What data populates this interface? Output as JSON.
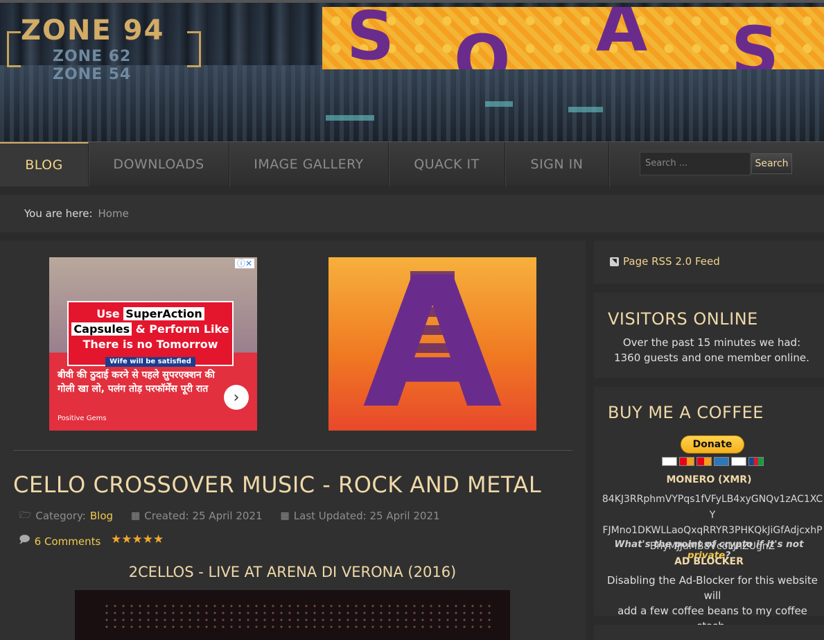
{
  "header": {
    "logo": {
      "line1": "ZONE 94",
      "line2": "ZONE 62",
      "line3": "ZONE 54"
    },
    "banner_letters": [
      "S",
      "O",
      "A",
      "S"
    ]
  },
  "nav": {
    "items": [
      {
        "label": "BLOG",
        "active": true
      },
      {
        "label": "DOWNLOADS",
        "active": false
      },
      {
        "label": "IMAGE GALLERY",
        "active": false
      },
      {
        "label": "QUACK IT",
        "active": false
      },
      {
        "label": "SIGN IN",
        "active": false
      }
    ],
    "search": {
      "placeholder": "Search ...",
      "button_label": "Search"
    }
  },
  "breadcrumb": {
    "label": "You are here:",
    "home": "Home"
  },
  "ads": {
    "ad1": {
      "adchoices": "ⓘ✕",
      "headline_pre": "Use",
      "headline_highlight1": "SuperAction",
      "headline_highlight2": "Capsules",
      "headline_mid": "& Perform Like",
      "headline_end": "There is no Tomorrow",
      "tagline": "Wife will be satisfied",
      "hindi_text": "बीवी की ठुदाई करने से पहले सुपरएक्शन की गोली खा लो, पलंग तोड़ परफॉर्मेंस पूरी रात",
      "brand": "Positive Gems"
    },
    "ad2": {
      "letter": "A"
    }
  },
  "article": {
    "title": "CELLO CROSSOVER MUSIC - ROCK AND METAL",
    "category_label": "Category:",
    "category": "Blog",
    "created": "Created: 25 April 2021",
    "updated": "Last Updated: 25 April 2021",
    "comments": "6 Comments",
    "rating": 5,
    "rating_stars": "★★★★★",
    "video_title": "2CELLOS - LIVE AT ARENA DI VERONA (2016)"
  },
  "sidebar": {
    "rss": "Page RSS 2.0 Feed",
    "visitors": {
      "title": "VISITORS ONLINE",
      "line1": "Over the past 15 minutes we had:",
      "line2": "1360 guests and one member online."
    },
    "coffee": {
      "title": "BUY ME A COFFEE",
      "donate": "Donate",
      "monero_heading": "MONERO (XMR)",
      "xmr_line1": "84KJ3RRphmVYPqs1fVFyLB4xyGNQv1zAC1XCY",
      "xmr_line2": "FJMno1DKWLLaoQxqRRYR3PHKQkJiGfAdjcxhP",
      "xmr_line3": "BhyMJJuMB8VcoLJnZUgnZ",
      "crypto_note_pre": "What's the point of crypto if it's not",
      "crypto_note_em": "private",
      "crypto_note_post": "?",
      "adblock_heading": "AD BLOCKER",
      "adblock_line1": "Disabling the Ad-Blocker for this website will",
      "adblock_line2": "add a few coffee beans to my coffee stash."
    }
  },
  "colors": {
    "accent_gold": "#f2c94c",
    "title_cream": "#f0d9a8",
    "banner_orange": "#f3a622",
    "banner_purple": "#6a2c8c"
  }
}
